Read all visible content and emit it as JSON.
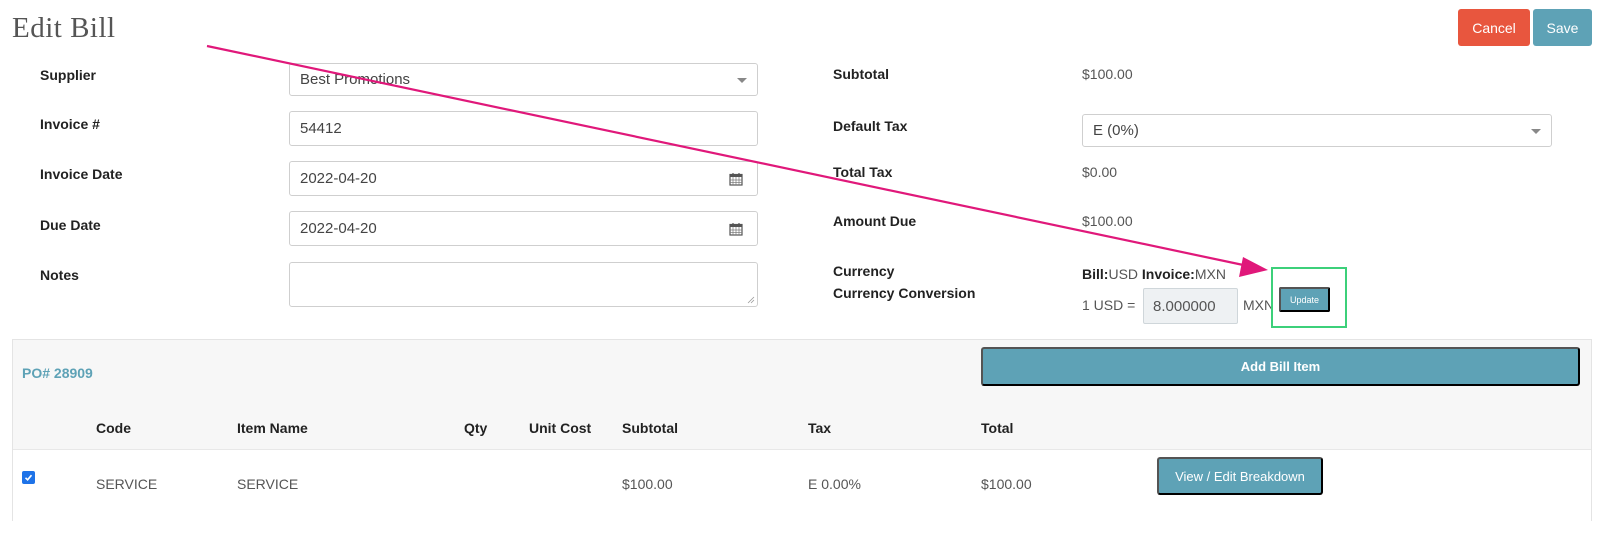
{
  "header": {
    "title": "Edit Bill",
    "cancel_label": "Cancel",
    "save_label": "Save"
  },
  "form_left": {
    "supplier_label": "Supplier",
    "supplier_value": "Best Promotions",
    "invoice_label": "Invoice #",
    "invoice_value": "54412",
    "invoice_date_label": "Invoice Date",
    "invoice_date_value": "2022-04-20",
    "due_date_label": "Due Date",
    "due_date_value": "2022-04-20",
    "notes_label": "Notes",
    "notes_value": ""
  },
  "form_right": {
    "subtotal_label": "Subtotal",
    "subtotal_value": "$100.00",
    "default_tax_label": "Default Tax",
    "default_tax_value": "E (0%)",
    "total_tax_label": "Total Tax",
    "total_tax_value": "$0.00",
    "amount_due_label": "Amount Due",
    "amount_due_value": "$100.00",
    "currency_label": "Currency",
    "currency_conversion_label": "Currency Conversion",
    "bill_currency_label": "Bill:",
    "bill_currency_value": "USD",
    "invoice_currency_label": "Invoice:",
    "invoice_currency_value": "MXN",
    "conversion_prefix": "1 USD =",
    "conversion_rate": "8.000000",
    "conversion_suffix": "MXN",
    "update_label": "Update"
  },
  "po_section": {
    "title": "PO# 28909",
    "add_item_label": "Add Bill Item",
    "columns": [
      "Code",
      "Item Name",
      "Qty",
      "Unit Cost",
      "Subtotal",
      "Tax",
      "Total"
    ],
    "rows": [
      {
        "checked": true,
        "code": "SERVICE",
        "item_name": "SERVICE",
        "qty": "",
        "unit_cost": "",
        "subtotal": "$100.00",
        "tax": "E 0.00%",
        "total": "$100.00",
        "action_label": "View / Edit Breakdown"
      }
    ]
  },
  "annotation": {
    "arrow_color": "#e0187a",
    "highlight_color": "#3cd07a"
  },
  "colors": {
    "primary": "#5ea2b6",
    "danger": "#e8563e"
  }
}
